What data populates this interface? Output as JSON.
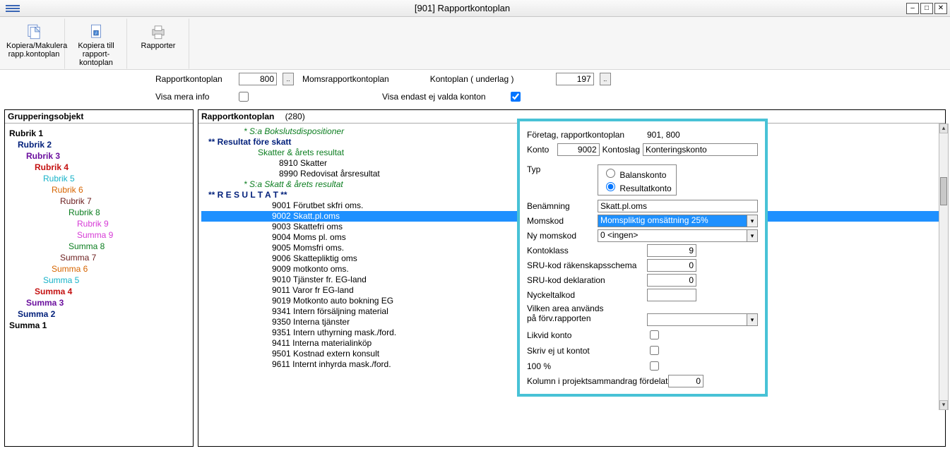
{
  "window": {
    "title": "[901]  Rapportkontoplan"
  },
  "toolbar": {
    "copy_makulera": "Kopiera/Makulera rapp.kontoplan",
    "kopiera_till": "Kopiera till rapport- kontoplan",
    "rapporter": "Rapporter"
  },
  "params": {
    "label_rapportkontoplan": "Rapportkontoplan",
    "val_rapportkontoplan": "800",
    "label_momsrapport": "Momsrapportkontoplan",
    "label_kontoplan": "Kontoplan ( underlag )",
    "val_kontoplan": "197",
    "label_visa_mera": "Visa mera info",
    "label_visa_endast": "Visa endast ej valda konton"
  },
  "grouping": {
    "header": "Grupperingsobjekt",
    "items": [
      {
        "label": "Rubrik 1",
        "color": "c-black",
        "indent": 0,
        "bold": true
      },
      {
        "label": "Rubrik 2",
        "color": "c-navy",
        "indent": 1,
        "bold": true
      },
      {
        "label": "Rubrik 3",
        "color": "c-purple",
        "indent": 2,
        "bold": true
      },
      {
        "label": "Rubrik 4",
        "color": "c-red",
        "indent": 3,
        "bold": true
      },
      {
        "label": "Rubrik 5",
        "color": "c-cyan",
        "indent": 4,
        "bold": false
      },
      {
        "label": "Rubrik 6",
        "color": "c-orange",
        "indent": 5,
        "bold": false
      },
      {
        "label": "Rubrik 7",
        "color": "c-darkred",
        "indent": 6,
        "bold": false
      },
      {
        "label": "Rubrik 8",
        "color": "c-green",
        "indent": 7,
        "bold": false
      },
      {
        "label": "Rubrik 9",
        "color": "c-magenta",
        "indent": 8,
        "bold": false
      },
      {
        "label": "Summa 9",
        "color": "c-magenta",
        "indent": 8,
        "bold": false
      },
      {
        "label": "Summa 8",
        "color": "c-green",
        "indent": 7,
        "bold": false
      },
      {
        "label": "Summa 7",
        "color": "c-darkred",
        "indent": 6,
        "bold": false
      },
      {
        "label": "Summa 6",
        "color": "c-orange",
        "indent": 5,
        "bold": false
      },
      {
        "label": "Summa 5",
        "color": "c-cyan",
        "indent": 4,
        "bold": false
      },
      {
        "label": "Summa 4",
        "color": "c-red",
        "indent": 3,
        "bold": true
      },
      {
        "label": "Summa 3",
        "color": "c-purple",
        "indent": 2,
        "bold": true
      },
      {
        "label": "Summa 2",
        "color": "c-navy",
        "indent": 1,
        "bold": true
      },
      {
        "label": "Summa 1",
        "color": "c-black",
        "indent": 0,
        "bold": true
      }
    ]
  },
  "midpanel": {
    "header": "Rapportkontoplan",
    "count": "(280)",
    "lines": [
      {
        "cls": "i1",
        "text": "* S:a Bokslutsdispositioner"
      },
      {
        "cls": "i1b",
        "text": "** Resultat före skatt"
      },
      {
        "cls": "i2g",
        "text": "Skatter & årets resultat"
      },
      {
        "cls": "i3",
        "text": "8910 Skatter"
      },
      {
        "cls": "i3",
        "text": "8990 Redovisat årsresultat"
      },
      {
        "cls": "i1",
        "text": "* S:a Skatt & årets resultat"
      },
      {
        "cls": "i1b",
        "text": "** R E S U L T A T **"
      },
      {
        "cls": "i4",
        "text": "9001 Förutbet skfri oms."
      },
      {
        "cls": "i4 sel",
        "text": "9002 Skatt.pl.oms"
      },
      {
        "cls": "i4",
        "text": "9003 Skattefri oms"
      },
      {
        "cls": "i4",
        "text": "9004 Moms pl. oms"
      },
      {
        "cls": "i4",
        "text": "9005 Momsfri oms."
      },
      {
        "cls": "i4",
        "text": "9006 Skattepliktig oms"
      },
      {
        "cls": "i4",
        "text": "9009 motkonto oms."
      },
      {
        "cls": "i4",
        "text": "9010 Tjänster fr. EG-land"
      },
      {
        "cls": "i4",
        "text": "9011 Varor fr EG-land"
      },
      {
        "cls": "i4",
        "text": "9019 Motkonto auto bokning EG"
      },
      {
        "cls": "i4",
        "text": "9341 Intern försäljning material"
      },
      {
        "cls": "i4",
        "text": "9350 Interna tjänster"
      },
      {
        "cls": "i4",
        "text": "9351 Intern uthyrning mask./ford."
      },
      {
        "cls": "i4",
        "text": "9411 Interna materialinköp"
      },
      {
        "cls": "i4",
        "text": "9501 Kostnad extern konsult"
      },
      {
        "cls": "i4",
        "text": "9611 Internt inhyrda mask./ford."
      }
    ]
  },
  "detail": {
    "foretag_lbl": "Företag, rapportkontoplan",
    "foretag_val": "901, 800",
    "konto_lbl": "Konto",
    "konto_val": "9002",
    "kontoslag_lbl": "Kontoslag",
    "kontoslag_val": "Konteringskonto",
    "typ_lbl": "Typ",
    "typ_balans": "Balanskonto",
    "typ_resultat": "Resultatkonto",
    "benamning_lbl": "Benämning",
    "benamning_val": "Skatt.pl.oms",
    "momskod_lbl": "Momskod",
    "momskod_val": "Momspliktig omsättning 25%",
    "nymomskod_lbl": "Ny momskod",
    "nymomskod_val": "0 <ingen>",
    "kontoklass_lbl": "Kontoklass",
    "kontoklass_val": "9",
    "sru_raken_lbl": "SRU-kod räkenskapsschema",
    "sru_raken_val": "0",
    "sru_dekl_lbl": "SRU-kod deklaration",
    "sru_dekl_val": "0",
    "nyckeltal_lbl": "Nyckeltalkod",
    "nyckeltal_val": "",
    "area_lbl1": "Vilken area används",
    "area_lbl2": "på förv.rapporten",
    "area_val": "",
    "likvid_lbl": "Likvid konto",
    "skrivej_lbl": "Skriv ej ut kontot",
    "hundred_lbl": "100 %",
    "kolumn_lbl": "Kolumn i projektsammandrag fördelat",
    "kolumn_val": "0"
  }
}
